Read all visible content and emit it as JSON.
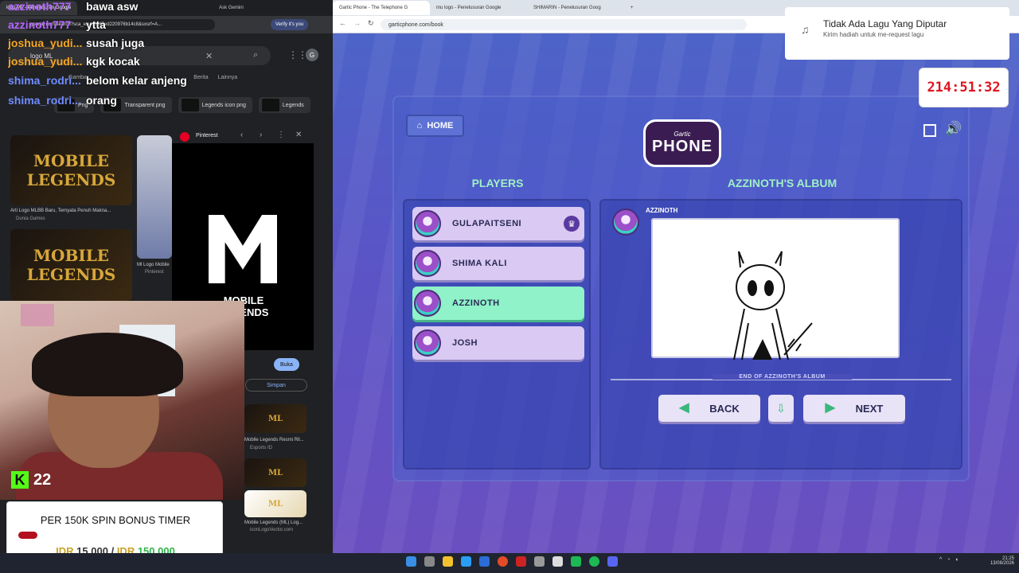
{
  "left_browser": {
    "tabs": [
      "logo ML - Penelusuran Google",
      "Ask Gemini"
    ],
    "url": "google.com/search?sca_esv=0147ed220976b14c8&sxsrf=A...",
    "verify": "Verify it's you",
    "search_query": "logo ML",
    "nav_tabs": [
      "Gambar",
      "Berita",
      "Lainnya"
    ],
    "chips": [
      "Png",
      "Transparent png",
      "Legends icon png",
      "Legends"
    ],
    "images": [
      {
        "title": "MOBILE LEGENDS",
        "caption": "Arti Logo MLBB Baru, Ternyata Penuh Makna...",
        "source": "Dunia Games"
      },
      {
        "title": "MOBILE LEGENDS",
        "caption": "Ml Logo Mobile",
        "source": "Pinterest"
      }
    ],
    "side_panel": {
      "source": "Pinterest",
      "logo_text": "MOBILE LEGENDS",
      "open_label": "Buka",
      "save_label": "Simpan"
    },
    "related": [
      {
        "caption": "Mobile Legends Resmi Ril...",
        "source": "Esports ID"
      },
      {
        "caption": "Mobile Legends (ML) Log...",
        "source": "iconLogoVector.com"
      }
    ]
  },
  "chat": [
    {
      "user": "azzinoth777",
      "message": "bawa asw",
      "color": "#b566ff"
    },
    {
      "user": "azzinoth777",
      "message": "ytta",
      "color": "#b566ff"
    },
    {
      "user": "joshua_yudi...",
      "message": "susah juga",
      "color": "#f5a623"
    },
    {
      "user": "joshua_yudi...",
      "message": "kgk kocak",
      "color": "#f5a623"
    },
    {
      "user": "shima_rodri...",
      "message": "belom kelar anjeng",
      "color": "#6f8cff"
    },
    {
      "user": "shima_rodri...",
      "message": "orang",
      "color": "#6f8cff"
    }
  ],
  "kick_badge": {
    "letter": "K",
    "count": "22"
  },
  "promo": {
    "title": "PER 150K SPIN BONUS TIMER",
    "currency": "IDR",
    "current": "15.000",
    "separator": "/",
    "target": "150.000",
    "progress_fraction": 0.1
  },
  "right_browser": {
    "tabs": [
      "Gartic Phone - The Telephone G",
      "mu logo - Penelusuran Google",
      "SHIMARIN - Penelusuran Goog"
    ],
    "url": "garticphone.com/book"
  },
  "game": {
    "home_label": "HOME",
    "logo_small": "Gartic",
    "logo_big": "PHONE",
    "players_heading": "PLAYERS",
    "album_heading": "AZZINOTH'S ALBUM",
    "players": [
      {
        "name": "GULAPAITSENI",
        "host": true,
        "active": false
      },
      {
        "name": "SHIMA KALI",
        "host": false,
        "active": false
      },
      {
        "name": "AZZINOTH",
        "host": false,
        "active": true
      },
      {
        "name": "JOSH",
        "host": false,
        "active": false
      }
    ],
    "album_author": "AZZINOTH",
    "end_label": "END OF AZZINOTH'S ALBUM",
    "back_label": "BACK",
    "next_label": "NEXT",
    "accent": "#9ff0c5"
  },
  "music": {
    "title": "Tidak Ada Lagu Yang Diputar",
    "subtitle": "Kirim hadiah untuk me-request lagu"
  },
  "timer": "214:51:32",
  "taskbar": {
    "time": "21:25",
    "date": "13/08/2026"
  }
}
